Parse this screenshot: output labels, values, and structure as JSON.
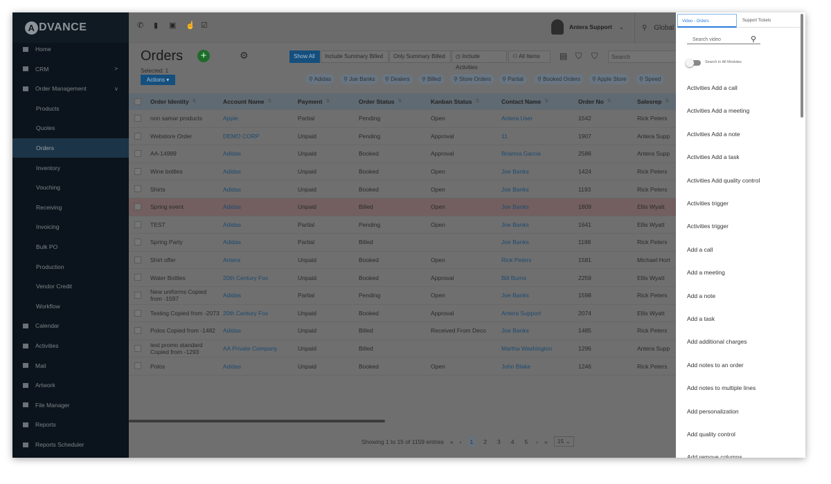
{
  "brand": "DVANCE",
  "brand_letter": "A",
  "sidebar": {
    "items": [
      {
        "label": "Home",
        "icon": "dashboard-icon"
      },
      {
        "label": "CRM",
        "icon": "briefcase-icon",
        "caret": ">"
      },
      {
        "label": "Order Management",
        "icon": "list-icon",
        "caret": "v"
      },
      {
        "label": "Products",
        "sub": true
      },
      {
        "label": "Quotes",
        "sub": true
      },
      {
        "label": "Orders",
        "sub": true,
        "selected": true
      },
      {
        "label": "Inventory",
        "sub": true
      },
      {
        "label": "Vouching",
        "sub": true
      },
      {
        "label": "Receiving",
        "sub": true
      },
      {
        "label": "Invoicing",
        "sub": true
      },
      {
        "label": "Bulk PO",
        "sub": true
      },
      {
        "label": "Production",
        "sub": true
      },
      {
        "label": "Vendor Credit",
        "sub": true
      },
      {
        "label": "Workflow",
        "sub": true
      },
      {
        "label": "Calendar",
        "icon": "calendar-icon"
      },
      {
        "label": "Activities",
        "icon": "activities-icon"
      },
      {
        "label": "Mail",
        "icon": "mail-icon"
      },
      {
        "label": "Artwork",
        "icon": "artwork-icon"
      },
      {
        "label": "File Manager",
        "icon": "folder-icon"
      },
      {
        "label": "Reports",
        "icon": "chart-icon"
      },
      {
        "label": "Reports Scheduler",
        "icon": "chart-icon"
      }
    ]
  },
  "topbar": {
    "user": "Antera Support",
    "global_search": "Global S"
  },
  "page": {
    "title": "Orders",
    "selected": "Selected: 1",
    "actions": "Actions ▾",
    "search_placeholder": "Search",
    "filters": [
      "Show All",
      "Include Summary Billed",
      "Only Summary Billed",
      "◷ Include Activities",
      "⚇ All Items"
    ],
    "chips": [
      "Adidas",
      "Joe Banks",
      "Dealers",
      "Billed",
      "Store Orders",
      "Partial",
      "Booked Orders",
      "Apple Store",
      "Speed"
    ]
  },
  "table": {
    "headers": [
      "Order Identity",
      "Account Name",
      "Payment",
      "Order Status",
      "Kanban Status",
      "Contact Name",
      "Order No",
      "Salesrep"
    ],
    "rows": [
      [
        "non samar products",
        "Apple",
        "Partial",
        "Pending",
        "Open",
        "Antera User",
        "1542",
        "Rick Peters"
      ],
      [
        "Webstore Order",
        "DEMO CORP",
        "Unpaid",
        "Pending",
        "Approval",
        "11",
        "1907",
        "Antera Supp"
      ],
      [
        "AA-14989",
        "Adidas",
        "Unpaid",
        "Booked",
        "Approval",
        "Brianna Garcia",
        "2586",
        "Antera Supp"
      ],
      [
        "Wine bottles",
        "Adidas",
        "Unpaid",
        "Booked",
        "Open",
        "Joe Banks",
        "1424",
        "Rick Peters"
      ],
      [
        "Shirts",
        "Adidas",
        "Unpaid",
        "Booked",
        "Open",
        "Joe Banks",
        "1193",
        "Rick Peters"
      ],
      [
        "Spring event",
        "Adidas",
        "Unpaid",
        "Billed",
        "Open",
        "Joe Banks",
        "1809",
        "Ellis Wyatt"
      ],
      [
        "TEST",
        "Adidas",
        "Partial",
        "Pending",
        "Open",
        "Joe Banks",
        "1641",
        "Ellis Wyatt"
      ],
      [
        "Spring Party",
        "Adidas",
        "Partial",
        "Billed",
        "",
        "Joe Banks",
        "1188",
        "Rick Peters"
      ],
      [
        "Shirt offer",
        "Antera",
        "Unpaid",
        "Booked",
        "Open",
        "Rick Peters",
        "1581",
        "Michael Hort"
      ],
      [
        "Water Bottles",
        "20th Century Fox",
        "Unpaid",
        "Booked",
        "Approval",
        "Bill Burns",
        "2259",
        "Ellis Wyatt"
      ],
      [
        "New uniforms Copied from -1597",
        "Adidas",
        "Partial",
        "Pending",
        "Open",
        "Joe Banks",
        "1598",
        "Rick Peters"
      ],
      [
        "Testing Copied from -2073",
        "20th Century Fox",
        "Unpaid",
        "Booked",
        "Approval",
        "Antera Support",
        "2074",
        "Ellis Wyatt"
      ],
      [
        "Polos Copied from -1482",
        "Adidas",
        "Unpaid",
        "Billed",
        "Received From Deco",
        "Joe Banks",
        "1485",
        "Rick Peters"
      ],
      [
        "test promo standard Copied from -1293",
        "AA Private Company",
        "Unpaid",
        "Billed",
        "",
        "Martha Washington",
        "1296",
        "Antera Supp"
      ],
      [
        "Polos",
        "Adidas",
        "Unpaid",
        "Booked",
        "Open",
        "John Blake",
        "1246",
        "Rick Peters"
      ]
    ],
    "highlight_row": 5
  },
  "pager": {
    "info": "Showing 1 to 15 of 1159 entries",
    "first": "«",
    "prev": "‹",
    "pages": [
      "1",
      "2",
      "3",
      "4",
      "5"
    ],
    "next": "›",
    "last": "»",
    "page_size": "15 ⌄"
  },
  "panel": {
    "tabs": [
      "Video - Orders",
      "Support Tickets"
    ],
    "search_placeholder": "Search video",
    "toggle_label": "Search in All Modules",
    "items": [
      "Activities Add a call",
      "Activities Add a meeting",
      "Activities Add a note",
      "Activities Add a task",
      "Activities Add quality control",
      "Activities trigger",
      "Activities trigger",
      "Add a call",
      "Add a meeting",
      "Add a note",
      "Add a task",
      "Add additional charges",
      "Add notes to an order",
      "Add notes to multiple lines",
      "Add personalization",
      "Add quality control",
      "Add remove columns"
    ]
  }
}
